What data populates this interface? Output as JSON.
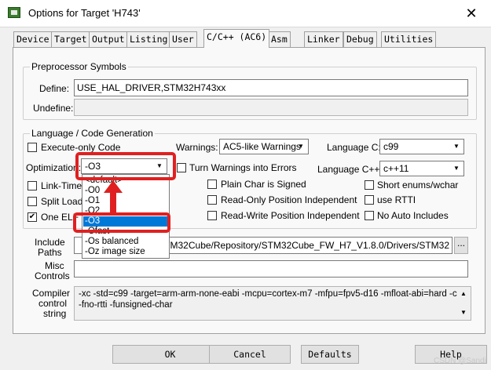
{
  "window": {
    "title": "Options for Target 'H743'",
    "close": "✕"
  },
  "tabs": [
    "Device",
    "Target",
    "Output",
    "Listing",
    "User",
    "C/C++ (AC6)",
    "Asm",
    "Linker",
    "Debug",
    "Utilities"
  ],
  "preprocessor": {
    "group_label": "Preprocessor Symbols",
    "define_label": "Define:",
    "define_value": "USE_HAL_DRIVER,STM32H743xx",
    "undefine_label": "Undefine:",
    "undefine_value": ""
  },
  "language": {
    "group_label": "Language / Code Generation",
    "execute_only_label": "Execute-only Code",
    "optimization_label": "Optimization:",
    "optimization_value": "-O3",
    "link_time_label": "Link-Time",
    "split_load_label": "Split Load",
    "one_elf_label": "One ELF S",
    "warnings_label": "Warnings:",
    "warnings_value": "AC5-like Warnings",
    "turn_warnings_label": "Turn Warnings into Errors",
    "plain_char_label": "Plain Char is Signed",
    "ro_pos_label": "Read-Only Position Independent",
    "rw_pos_label": "Read-Write Position Independent",
    "language_c_label": "Language C:",
    "language_c_value": "c99",
    "language_cpp_label": "Language C++:",
    "language_cpp_value": "c++11",
    "short_enums_label": "Short enums/wchar",
    "use_rtti_label": "use RTTI",
    "no_auto_includes_label": "No Auto Includes",
    "one_elf_checked": "✔"
  },
  "optimization_options": [
    "<default>",
    "-O0",
    "-O1",
    "-O2",
    "-O3",
    "-Ofast",
    "-Os balanced",
    "-Oz image size"
  ],
  "include": {
    "label_line1": "Include",
    "label_line2": "Paths",
    "value": "anti/STM32Cube/Repository/STM32Cube_FW_H7_V1.8.0/Drivers/STM32",
    "browse": "..."
  },
  "misc": {
    "label_line1": "Misc",
    "label_line2": "Controls",
    "value": ""
  },
  "compiler": {
    "label_line1": "Compiler",
    "label_line2": "control",
    "label_line3": "string",
    "line1": "-xc -std=c99 -target=arm-arm-none-eabi -mcpu=cortex-m7 -mfpu=fpv5-d16 -mfloat-abi=hard -c",
    "line2": "-fno-rtti -funsigned-char"
  },
  "buttons": {
    "ok": "OK",
    "cancel": "Cancel",
    "defaults": "Defaults",
    "help": "Help"
  },
  "watermark": "CSDN @Sandi"
}
